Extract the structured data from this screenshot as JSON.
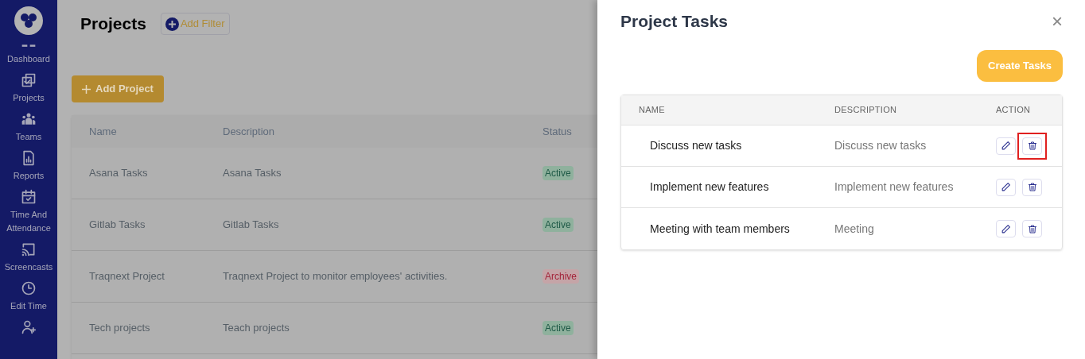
{
  "sidebar": {
    "items": [
      {
        "label": "Dashboard"
      },
      {
        "label": "Projects"
      },
      {
        "label": "Teams"
      },
      {
        "label": "Reports"
      },
      {
        "label": "Time And Attendance"
      },
      {
        "label": "Screencasts"
      },
      {
        "label": "Edit Time"
      }
    ]
  },
  "page": {
    "title": "Projects",
    "filter_button": "Add Filter",
    "add_button": "Add Project"
  },
  "projects_table": {
    "columns": [
      "Name",
      "Description",
      "Status"
    ],
    "rows": [
      {
        "name": "Asana Tasks",
        "description": "Asana Tasks",
        "status": "Active",
        "kind": "active"
      },
      {
        "name": "Gitlab Tasks",
        "description": "Gitlab Tasks",
        "status": "Active",
        "kind": "active"
      },
      {
        "name": "Traqnext Project",
        "description": "Traqnext Project to monitor employees' activities.",
        "status": "Archive",
        "kind": "archive"
      },
      {
        "name": "Tech projects",
        "description": "Teach projects",
        "status": "Active",
        "kind": "active"
      }
    ]
  },
  "drawer": {
    "title": "Project Tasks",
    "close": "×",
    "create_button": "Create Tasks",
    "columns": [
      "NAME",
      "DESCRIPTION",
      "ACTION"
    ],
    "rows": [
      {
        "name": "Discuss new tasks",
        "description": "Discuss new tasks",
        "highlighted": true
      },
      {
        "name": "Implement new features",
        "description": "Implement new features",
        "highlighted": false
      },
      {
        "name": "Meeting with team members",
        "description": "Meeting",
        "highlighted": false
      }
    ]
  }
}
